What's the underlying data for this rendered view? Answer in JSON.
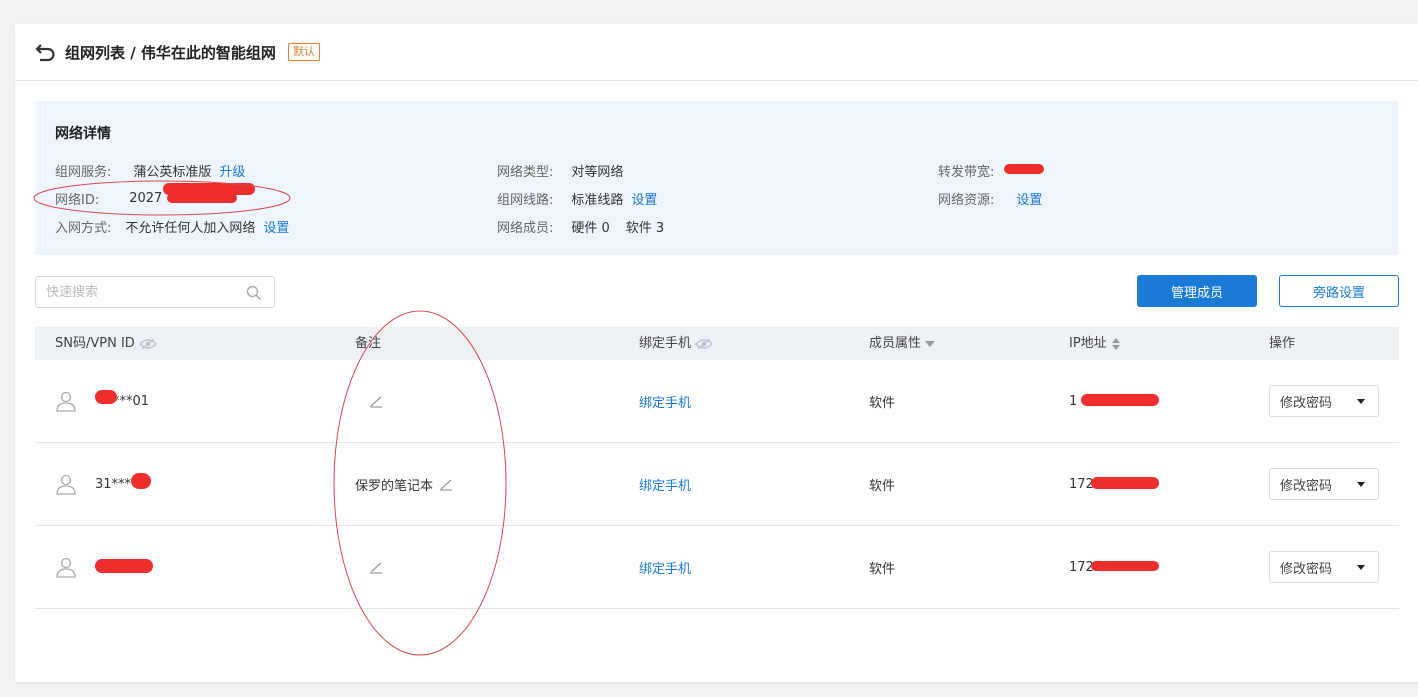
{
  "header": {
    "title": "组网列表 / 伟华在此的智能组网",
    "default_tag": "默认"
  },
  "details": {
    "title": "网络详情",
    "service_label": "组网服务:",
    "service_value": "蒲公英标准版",
    "upgrade_link": "升级",
    "network_id_label": "网络ID:",
    "network_id_partial": "2027",
    "join_label": "入网方式:",
    "join_value": "不允许任何人加入网络",
    "join_setting": "设置",
    "type_label": "网络类型:",
    "type_value": "对等网络",
    "line_label": "组网线路:",
    "line_value": "标准线路",
    "line_setting": "设置",
    "members_label": "网络成员:",
    "members_hw": "硬件 0",
    "members_sw": "软件 3",
    "bandwidth_label": "转发带宽:",
    "resource_label": "网络资源:",
    "resource_setting": "设置"
  },
  "search": {
    "placeholder": "快速搜索"
  },
  "buttons": {
    "manage": "管理成员",
    "bypass": "旁路设置"
  },
  "table": {
    "columns": {
      "sn": "SN码/VPN ID",
      "remark": "备注",
      "phone": "绑定手机",
      "attr": "成员属性",
      "ip": "IP地址",
      "ops": "操作"
    },
    "rows": [
      {
        "sn": "***01",
        "remark": "",
        "phone": "绑定手机",
        "attr": "软件",
        "ip": "1",
        "op": "修改密码"
      },
      {
        "sn": "31****",
        "remark": "保罗的笔记本",
        "phone": "绑定手机",
        "attr": "软件",
        "ip": "172",
        "op": "修改密码"
      },
      {
        "sn": "",
        "remark": "",
        "phone": "绑定手机",
        "attr": "软件",
        "ip": "172",
        "op": "修改密码"
      }
    ]
  },
  "colors": {
    "accent": "#1a7ad6",
    "redaction": "#ee2d2d",
    "tag": "#e0803a"
  }
}
